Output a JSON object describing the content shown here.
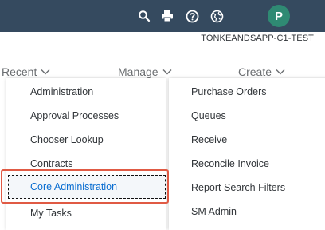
{
  "shellbar": {
    "avatar_initial": "P",
    "icons": [
      "search-icon",
      "print-icon",
      "help-icon",
      "globe-icon"
    ]
  },
  "realm": "TONKEANDSAPP-C1-TEST",
  "nav": {
    "recent": "Recent",
    "manage": "Manage",
    "create": "Create"
  },
  "manage_menu": {
    "items": [
      "Administration",
      "Approval Processes",
      "Chooser Lookup",
      "Contracts",
      "Core Administration",
      "My Tasks"
    ],
    "selected": "Core Administration"
  },
  "create_menu": {
    "items": [
      "Purchase Orders",
      "Queues",
      "Receive",
      "Reconcile Invoice",
      "Report Search Filters",
      "SM Admin"
    ]
  },
  "colors": {
    "shellbar": "#354a5f",
    "avatar": "#2f8a73",
    "highlight_border": "#e05a44",
    "selected_text": "#0a6ed1"
  }
}
